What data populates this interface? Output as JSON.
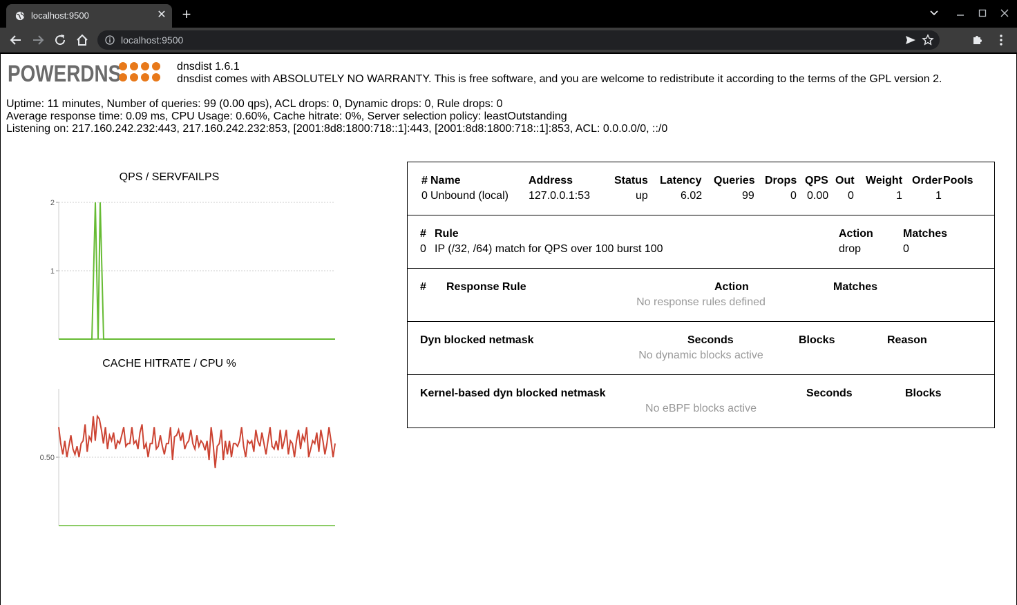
{
  "browser": {
    "tab_title": "localhost:9500",
    "url": "localhost:9500"
  },
  "header": {
    "logo_text": "POWERDNS",
    "version": "dnsdist 1.6.1",
    "warranty": "dnsdist comes with ABSOLUTELY NO WARRANTY. This is free software, and you are welcome to redistribute it according to the terms of the GPL version 2."
  },
  "stats": {
    "uptime_line": "Uptime: 11 minutes, Number of queries: 99 (0.00 qps), ACL drops: 0, Dynamic drops: 0, Rule drops: 0",
    "response_line": "Average response time: 0.09 ms, CPU Usage: 0.60%, Cache hitrate: 0%, Server selection policy: leastOutstanding",
    "listening_line": "Listening on: 217.160.242.232:443, 217.160.242.232:853, [2001:8d8:1800:718::1]:443, [2001:8d8:1800:718::1]:853, ACL: 0.0.0.0/0, ::/0"
  },
  "chart_data": [
    {
      "type": "line",
      "title": "QPS / SERVFAILPS",
      "yticks": [
        "2",
        "1"
      ],
      "ylim": [
        0,
        2
      ],
      "colors": [
        "#66bb33",
        "#aa3333"
      ],
      "series": [
        {
          "values": [
            0,
            0,
            0,
            0,
            0,
            0,
            0,
            0,
            0,
            0,
            0,
            0,
            0,
            0,
            0,
            0,
            0,
            0,
            0,
            0,
            0,
            0,
            0,
            0,
            0,
            0,
            0,
            0,
            0,
            0,
            0,
            0,
            0,
            0,
            0,
            0,
            0,
            0,
            0,
            0,
            0,
            0,
            0,
            0,
            0,
            0,
            0,
            0,
            0,
            0,
            0,
            0,
            0,
            0,
            0,
            0,
            0,
            0,
            0,
            0,
            0,
            0,
            0,
            0,
            0,
            0,
            0,
            0,
            0,
            0,
            0,
            0,
            0,
            0,
            0,
            0,
            0,
            0,
            0,
            0,
            0,
            0,
            0,
            0,
            0,
            0,
            0,
            0,
            0,
            0,
            0,
            0,
            0,
            0,
            0,
            0,
            0,
            0,
            0,
            0,
            0,
            0,
            0,
            0,
            0,
            0,
            0,
            0,
            0,
            0,
            0,
            0,
            0,
            0,
            0,
            0,
            0,
            0,
            0,
            0,
            0,
            0,
            0,
            0,
            0,
            0,
            0,
            0,
            0,
            0,
            0,
            0,
            0,
            0,
            0,
            0,
            0,
            0,
            0,
            0,
            0,
            0,
            0,
            0,
            0,
            0,
            0,
            0,
            0,
            0,
            0,
            0,
            0,
            0,
            0,
            0,
            0,
            0,
            0,
            0,
            0,
            0,
            0,
            0,
            0,
            0,
            0,
            0,
            0,
            0,
            0,
            0,
            0,
            0,
            0,
            0,
            0,
            0,
            0,
            0,
            0,
            0,
            0,
            0,
            0,
            0,
            0,
            0,
            0,
            0,
            0,
            0,
            0,
            0,
            0,
            0,
            0,
            0,
            0,
            0
          ]
        },
        {
          "values": []
        }
      ]
    },
    {
      "type": "line",
      "title": "CACHE HITRATE / CPU %",
      "yticks": [
        "0.50"
      ],
      "ylim": [
        0,
        1
      ],
      "colors": [
        "#66bb33",
        "#cc4433"
      ]
    }
  ],
  "qps_points": [
    [
      0,
      0
    ],
    [
      48,
      0
    ],
    [
      53,
      2
    ],
    [
      57,
      0
    ],
    [
      60,
      2
    ],
    [
      65,
      0
    ],
    [
      400,
      0
    ]
  ],
  "cpu_values": [
    0.72,
    0.6,
    0.52,
    0.62,
    0.5,
    0.58,
    0.66,
    0.56,
    0.52,
    0.58,
    0.5,
    0.6,
    0.62,
    0.74,
    0.54,
    0.65,
    0.62,
    0.8,
    0.62,
    0.8,
    0.78,
    0.7,
    0.6,
    0.72,
    0.56,
    0.66,
    0.62,
    0.68,
    0.56,
    0.62,
    0.6,
    0.66,
    0.72,
    0.58,
    0.6,
    0.6,
    0.72,
    0.6,
    0.62,
    0.56,
    0.68,
    0.74,
    0.56,
    0.6,
    0.5,
    0.6,
    0.6,
    0.72,
    0.56,
    0.58,
    0.66,
    0.58,
    0.52,
    0.6,
    0.6,
    0.72,
    0.48,
    0.65,
    0.66,
    0.7,
    0.62,
    0.68,
    0.56,
    0.6,
    0.62,
    0.7,
    0.6,
    0.56,
    0.66,
    0.58,
    0.62,
    0.6,
    0.55,
    0.62,
    0.48,
    0.72,
    0.6,
    0.42,
    0.58,
    0.6,
    0.7,
    0.48,
    0.62,
    0.52,
    0.62,
    0.5,
    0.6,
    0.6,
    0.58,
    0.62,
    0.72,
    0.58,
    0.5,
    0.62,
    0.6,
    0.62,
    0.54,
    0.7,
    0.62,
    0.58,
    0.68,
    0.6,
    0.52,
    0.62,
    0.72,
    0.58,
    0.56,
    0.62,
    0.55,
    0.7,
    0.56,
    0.62,
    0.7,
    0.52,
    0.62,
    0.6,
    0.5,
    0.62,
    0.7,
    0.56,
    0.66,
    0.62,
    0.72,
    0.5,
    0.56,
    0.62,
    0.6,
    0.68,
    0.54,
    0.7,
    0.62,
    0.52,
    0.6,
    0.72,
    0.62,
    0.5,
    0.6
  ],
  "servers": {
    "headers": [
      "#",
      "Name",
      "Address",
      "Status",
      "Latency",
      "Queries",
      "Drops",
      "QPS",
      "Out",
      "Weight",
      "Order",
      "Pools"
    ],
    "rows": [
      {
        "num": "0",
        "name": "Unbound (local)",
        "address": "127.0.0.1:53",
        "status": "up",
        "latency": "6.02",
        "queries": "99",
        "drops": "0",
        "qps": "0.00",
        "out": "0",
        "weight": "1",
        "order": "1",
        "pools": ""
      }
    ]
  },
  "rules": {
    "headers": [
      "#",
      "Rule",
      "Action",
      "Matches"
    ],
    "rows": [
      {
        "num": "0",
        "rule": "IP (/32, /64) match for QPS over 100 burst 100",
        "action": "drop",
        "matches": "0"
      }
    ]
  },
  "response_rules": {
    "headers": [
      "#",
      "Response Rule",
      "Action",
      "Matches"
    ],
    "empty": "No response rules defined"
  },
  "dyn_blocks": {
    "headers": [
      "Dyn blocked netmask",
      "Seconds",
      "Blocks",
      "Reason"
    ],
    "empty": "No dynamic blocks active"
  },
  "ebpf_blocks": {
    "headers": [
      "Kernel-based dyn blocked netmask",
      "Seconds",
      "Blocks"
    ],
    "empty": "No eBPF blocks active"
  }
}
